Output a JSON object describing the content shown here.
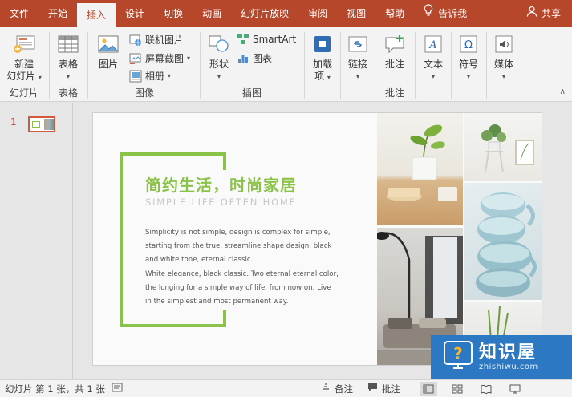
{
  "tabs": [
    {
      "label": "文件",
      "active": false
    },
    {
      "label": "开始",
      "active": false
    },
    {
      "label": "插入",
      "active": true
    },
    {
      "label": "设计",
      "active": false
    },
    {
      "label": "切换",
      "active": false
    },
    {
      "label": "动画",
      "active": false
    },
    {
      "label": "幻灯片放映",
      "active": false
    },
    {
      "label": "审阅",
      "active": false
    },
    {
      "label": "视图",
      "active": false
    },
    {
      "label": "帮助",
      "active": false
    }
  ],
  "tell_me": "告诉我",
  "share": "共享",
  "ribbon": {
    "slides": {
      "new_slide_line1": "新建",
      "new_slide_line2": "幻灯片",
      "group": "幻灯片"
    },
    "tables": {
      "table": "表格",
      "group": "表格"
    },
    "images": {
      "picture": "图片",
      "online_pictures": "联机图片",
      "screenshot": "屏幕截图",
      "album": "相册",
      "group": "图像"
    },
    "illustrations": {
      "shapes": "形状",
      "smartart": "SmartArt",
      "chart": "图表",
      "group": "插图"
    },
    "addins": {
      "line1": "加载",
      "line2": "项"
    },
    "links": {
      "label": "链接"
    },
    "comments": {
      "comment": "批注",
      "group": "批注"
    },
    "text": {
      "label": "文本"
    },
    "symbols": {
      "label": "符号"
    },
    "media": {
      "label": "媒体"
    }
  },
  "thumbnail": {
    "number": "1"
  },
  "slide": {
    "title": "简约生活，时尚家居",
    "subtitle": "SIMPLE LIFE OFTEN HOME",
    "body_lines": [
      "Simplicity is not simple, design is complex for simple,",
      "starting from the true, streamline shape design, black",
      "and white tone, eternal classic.",
      "White elegance, black classic. Two eternal eternal color,",
      "the longing for a simple way of life, from now on. Live",
      "in the simplest and most permanent way."
    ],
    "accent_color": "#8bc34a"
  },
  "status": {
    "slide_info": "幻灯片 第 1 张，共 1 张",
    "notes": "备注",
    "comments": "批注"
  },
  "watermark": {
    "cn": "知识屋",
    "en": "zhishiwu.com"
  },
  "colors": {
    "brand": "#b7472a",
    "watermark": "#2d78c2"
  }
}
